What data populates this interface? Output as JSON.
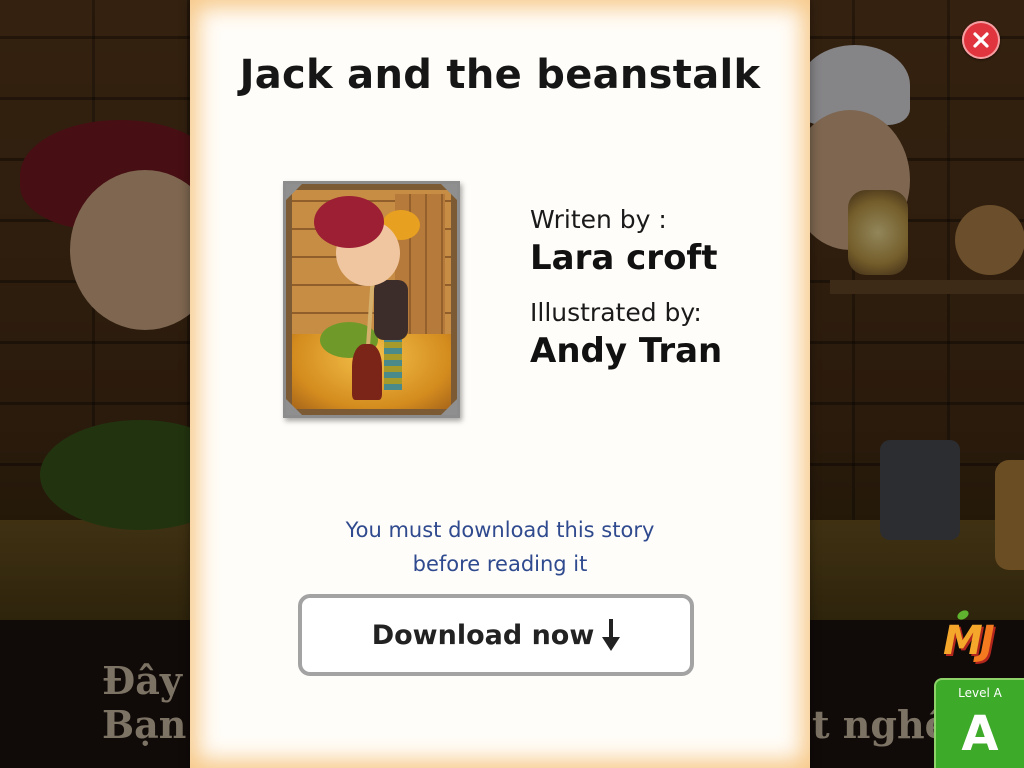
{
  "story": {
    "title": "Jack and the beanstalk",
    "written_by_label": "Writen by :",
    "author": "Lara croft",
    "illustrated_by_label": "Illustrated by:",
    "illustrator": "Andy Tran"
  },
  "notice": {
    "line1": "You must download this story",
    "line2": "before reading it"
  },
  "download_button": {
    "label": "Download now",
    "icon": "arrow-down-icon"
  },
  "close_button": {
    "icon": "close-icon",
    "color": "#e0343e"
  },
  "logo": {
    "text_m": "M",
    "text_j": "J"
  },
  "level": {
    "label": "Level A",
    "letter": "A",
    "color": "#3daa2a"
  },
  "background_captions": {
    "line1": "Đây",
    "line2": "Bạn",
    "line2_end": "t nghề"
  },
  "colors": {
    "panel_glow": "#f7c98b",
    "notice_text": "#2f4a8e",
    "button_border": "#a3a3a3"
  }
}
